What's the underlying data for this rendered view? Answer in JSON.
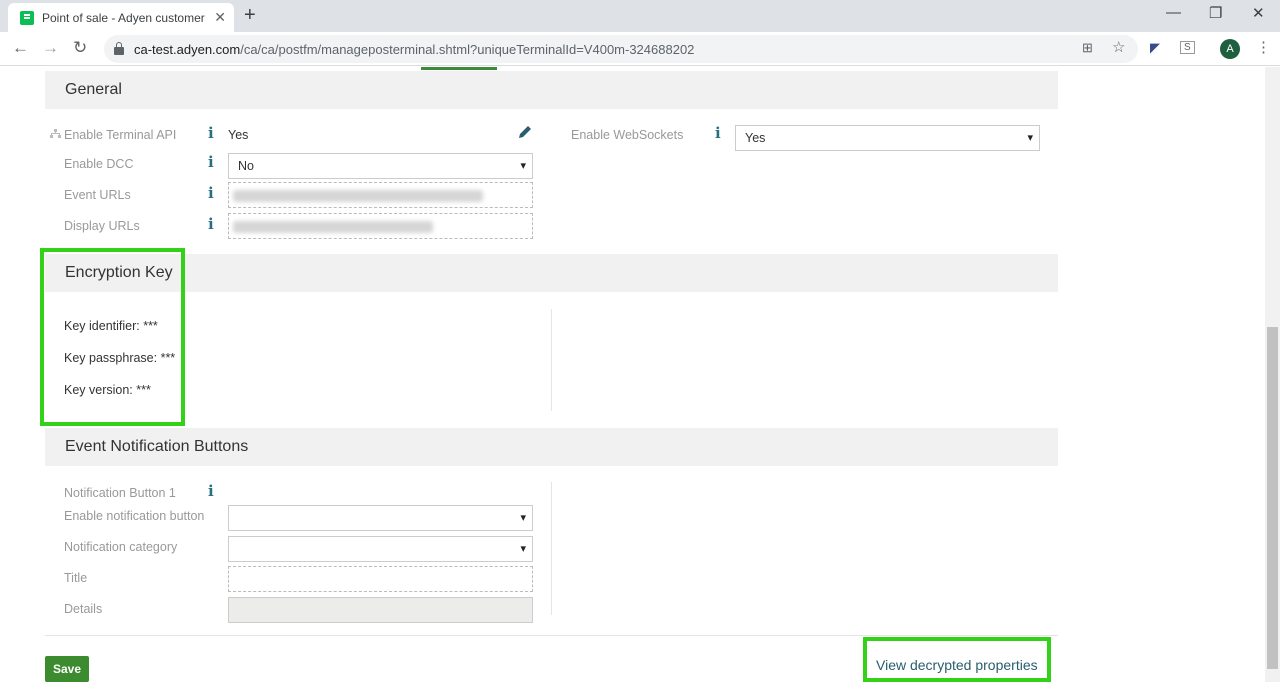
{
  "browser": {
    "tab_title": "Point of sale - Adyen customer a",
    "url_host": "ca-test.adyen.com",
    "url_path": "/ca/ca/postfm/manageposterminal.shtml?uniqueTerminalId=V400m-324688202"
  },
  "general": {
    "heading": "General",
    "enable_terminal_api_label": "Enable Terminal API",
    "enable_terminal_api_value": "Yes",
    "enable_dcc_label": "Enable DCC",
    "enable_dcc_value": "No",
    "event_urls_label": "Event URLs",
    "display_urls_label": "Display URLs",
    "enable_websockets_label": "Enable WebSockets",
    "enable_websockets_value": "Yes"
  },
  "encryption": {
    "heading": "Encryption Key",
    "key_identifier": "Key identifier: ***",
    "key_passphrase": "Key passphrase: ***",
    "key_version": "Key version: ***"
  },
  "notifications": {
    "heading": "Event Notification Buttons",
    "button1_label": "Notification Button 1",
    "enable_button_label": "Enable notification button",
    "category_label": "Notification category",
    "title_label": "Title",
    "details_label": "Details"
  },
  "footer": {
    "save_label": "Save",
    "view_decrypted_label": "View decrypted properties"
  },
  "icons": {
    "info_glyph": "i",
    "highlight_color": "#33d117",
    "accent_green": "#3d8b2f"
  }
}
